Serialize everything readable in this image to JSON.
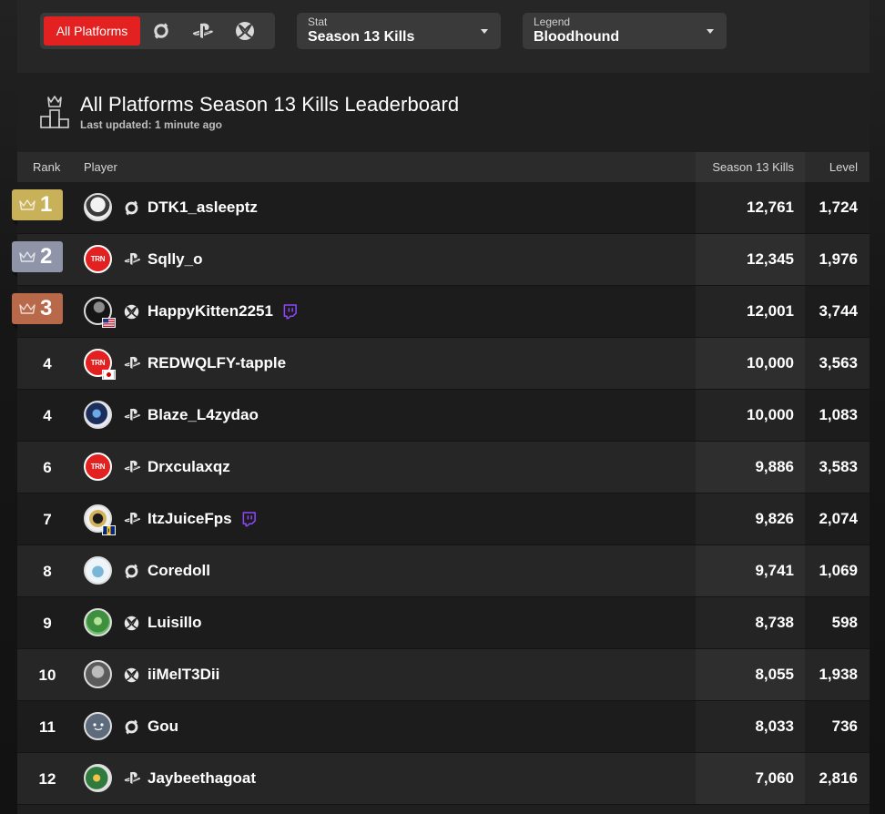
{
  "filters": {
    "platforms": [
      {
        "label": "All Platforms",
        "active": true
      },
      {
        "icon": "origin-icon"
      },
      {
        "icon": "playstation-icon"
      },
      {
        "icon": "xbox-icon"
      }
    ],
    "stat": {
      "label": "Stat",
      "value": "Season 13 Kills"
    },
    "legend": {
      "label": "Legend",
      "value": "Bloodhound"
    }
  },
  "header": {
    "title": "All Platforms Season 13 Kills Leaderboard",
    "updated": "Last updated: 1 minute ago"
  },
  "columns": {
    "rank": "Rank",
    "player": "Player",
    "stat": "Season 13 Kills",
    "level": "Level"
  },
  "colors": {
    "gold": "#c9b15a",
    "silver": "#8f94a8",
    "bronze": "#b8694a",
    "accent": "#e42121",
    "twitch": "#9146ff"
  },
  "rows": [
    {
      "rank": "1",
      "name": "DTK1_asleeptz",
      "platform": "origin",
      "kills": "12,761",
      "level": "1,724"
    },
    {
      "rank": "2",
      "name": "Sqlly_o",
      "platform": "playstation",
      "kills": "12,345",
      "level": "1,976"
    },
    {
      "rank": "3",
      "name": "HappyKitten2251",
      "platform": "xbox",
      "kills": "12,001",
      "level": "3,744",
      "twitch": true,
      "flag": "us"
    },
    {
      "rank": "4",
      "name": "REDWQLFY-tapple",
      "platform": "playstation",
      "kills": "10,000",
      "level": "3,563",
      "flag": "jp"
    },
    {
      "rank": "4",
      "name": "Blaze_L4zydao",
      "platform": "playstation",
      "kills": "10,000",
      "level": "1,083"
    },
    {
      "rank": "6",
      "name": "Drxculaxqz",
      "platform": "playstation",
      "kills": "9,886",
      "level": "3,583"
    },
    {
      "rank": "7",
      "name": "ItzJuiceFps",
      "platform": "playstation",
      "kills": "9,826",
      "level": "2,074",
      "twitch": true,
      "flag": "bb"
    },
    {
      "rank": "8",
      "name": "Coredoll",
      "platform": "origin",
      "kills": "9,741",
      "level": "1,069"
    },
    {
      "rank": "9",
      "name": "Luisillo",
      "platform": "xbox",
      "kills": "8,738",
      "level": "598"
    },
    {
      "rank": "10",
      "name": "iiMelT3Dii",
      "platform": "xbox",
      "kills": "8,055",
      "level": "1,938"
    },
    {
      "rank": "11",
      "name": "Gou",
      "platform": "origin",
      "kills": "8,033",
      "level": "736"
    },
    {
      "rank": "12",
      "name": "Jaybeethagoat",
      "platform": "playstation",
      "kills": "7,060",
      "level": "2,816"
    }
  ]
}
